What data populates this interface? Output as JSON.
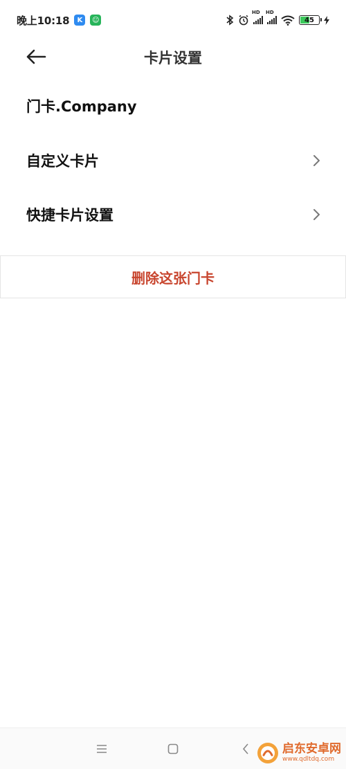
{
  "status_bar": {
    "time": "晚上10:18",
    "app_badges": [
      {
        "icon": "k-app-icon",
        "letter": "K",
        "color": "#2f8bf0"
      },
      {
        "icon": "chat-app-icon",
        "letter": "☺",
        "color": "#27b45a"
      }
    ],
    "signal_labels": [
      "HD",
      "HD"
    ],
    "battery_level": "45",
    "battery_fraction": 0.45,
    "battery_color": "#3bc95b"
  },
  "header": {
    "title": "卡片设置",
    "back_icon": "arrow-left-icon"
  },
  "settings": {
    "card_name": "门卡.Company",
    "items": [
      {
        "label": "自定义卡片",
        "icon": "chevron-right-icon"
      },
      {
        "label": "快捷卡片设置",
        "icon": "chevron-right-icon"
      }
    ]
  },
  "delete": {
    "label": "删除这张门卡",
    "color": "#c8452e"
  },
  "nav_bar": {
    "icons": [
      "menu-icon",
      "home-square-icon",
      "back-chevron-icon"
    ]
  },
  "watermark": {
    "name": "启东安卓网",
    "url": "www.qdltdq.com",
    "color": "#e06a2c"
  }
}
